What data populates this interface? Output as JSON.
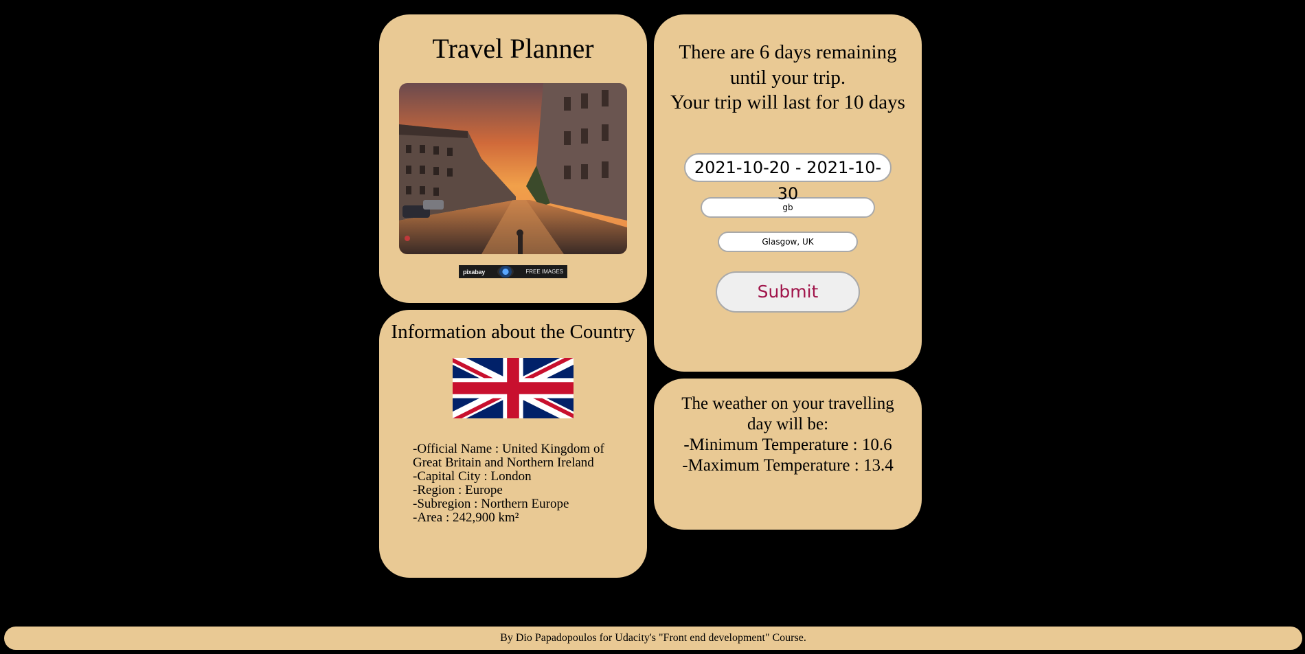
{
  "header": {
    "title": "Travel Planner",
    "pixabay": {
      "brand": "pixabay",
      "free": "FREE IMAGES"
    }
  },
  "country": {
    "title": "Information about the Country",
    "lines": [
      "-Official Name : United Kingdom of Great Britain and Northern Ireland",
      "-Capital City : London",
      "-Region : Europe",
      "-Subregion : Northern Europe",
      "-Area : 242,900 km²"
    ]
  },
  "trip": {
    "days_remaining": "There are 6 days remaining until your trip.",
    "duration": "Your trip will last for 10 days",
    "date_range": "2021-10-20 - 2021-10-30",
    "country_code": "gb",
    "city": "Glasgow, UK",
    "submit_label": "Submit"
  },
  "weather": {
    "intro": "The weather on your travelling day will be:",
    "min": "-Minimum Temperature : 10.6",
    "max": "-Maximum Temperature : 13.4"
  },
  "footer": {
    "text": "By Dio Papadopoulos for Udacity's \"Front end development\" Course."
  },
  "colors": {
    "card": "#e9c994",
    "background": "#000000",
    "submit_text": "#a0144a"
  }
}
